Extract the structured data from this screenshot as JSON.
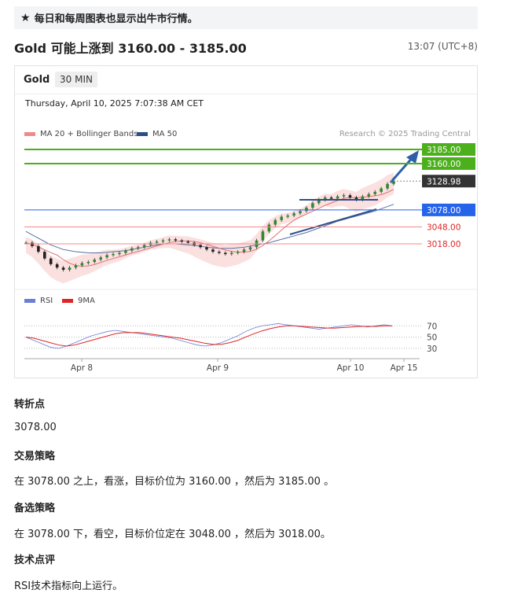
{
  "notice": {
    "icon": "star-icon",
    "text": "每日和每周图表也显示出牛市行情。"
  },
  "article": {
    "title": "Gold 可能上涨到 3160.00 - 3185.00",
    "time": "13:07 (UTC+8)"
  },
  "chart_card": {
    "asset": "Gold",
    "timeframe": "30 MIN",
    "datetime": "Thursday, April 10, 2025 7:07:38 AM CET"
  },
  "chart_data": {
    "type": "line",
    "legend": [
      {
        "name": "MA 20 + Bollinger Bands",
        "color": "#f08a8a"
      },
      {
        "name": "MA 50",
        "color": "#2d4f86"
      }
    ],
    "credit": "Research © 2025 Trading Central",
    "ylim": [
      3000,
      3200
    ],
    "levels": [
      {
        "value": "3185.00",
        "y": 3185,
        "style": "green"
      },
      {
        "value": "3160.00",
        "y": 3160,
        "style": "green"
      },
      {
        "value": "3128.98",
        "y": 3128.98,
        "style": "current"
      },
      {
        "value": "3078.00",
        "y": 3078,
        "style": "pivot"
      },
      {
        "value": "3048.00",
        "y": 3048,
        "style": "support"
      },
      {
        "value": "3018.00",
        "y": 3018,
        "style": "support"
      }
    ],
    "colors": {
      "green": "#4caf1c",
      "pivot": "#2563eb",
      "current": "#333333",
      "support": "#e02424",
      "ma50": "#5a6fa8",
      "bb": "#f7c6c6"
    },
    "price_close": [
      3020,
      3014,
      3004,
      2992,
      2982,
      2976,
      2972,
      2976,
      2980,
      2984,
      2986,
      2990,
      2994,
      2998,
      3000,
      3002,
      3006,
      3010,
      3012,
      3016,
      3020,
      3022,
      3024,
      3026,
      3024,
      3022,
      3020,
      3016,
      3012,
      3008,
      3004,
      3002,
      3000,
      3002,
      3004,
      3008,
      3012,
      3024,
      3040,
      3052,
      3060,
      3066,
      3068,
      3072,
      3076,
      3082,
      3090,
      3096,
      3100,
      3098,
      3102,
      3104,
      3100,
      3096,
      3102,
      3106,
      3110,
      3116,
      3124,
      3129
    ],
    "ma50": [
      3040,
      3034,
      3028,
      3022,
      3016,
      3012,
      3008,
      3006,
      3004,
      3003,
      3002,
      3002,
      3002,
      3003,
      3004,
      3005,
      3006,
      3008,
      3010,
      3012,
      3014,
      3016,
      3018,
      3018,
      3018,
      3017,
      3016,
      3015,
      3014,
      3012,
      3011,
      3010,
      3010,
      3010,
      3011,
      3012,
      3014,
      3016,
      3018,
      3020,
      3023,
      3026,
      3029,
      3032,
      3035,
      3038,
      3042,
      3046,
      3050,
      3054,
      3058,
      3061,
      3064,
      3067,
      3070,
      3073,
      3076,
      3080,
      3084,
      3088
    ],
    "rsi_legend": [
      {
        "name": "RSI",
        "color": "#6b7fd7"
      },
      {
        "name": "9MA",
        "color": "#e02424"
      }
    ],
    "rsi_ticks": [
      "70",
      "50",
      "30"
    ],
    "rsi": [
      50,
      44,
      38,
      32,
      30,
      34,
      40,
      46,
      52,
      56,
      60,
      62,
      60,
      58,
      56,
      54,
      52,
      50,
      48,
      44,
      40,
      36,
      34,
      36,
      40,
      46,
      52,
      60,
      66,
      70,
      72,
      74,
      72,
      70,
      68,
      66,
      64,
      66,
      68,
      70,
      72,
      70,
      68,
      70,
      72,
      70
    ],
    "rsi_ma": [
      50,
      48,
      44,
      40,
      36,
      34,
      36,
      40,
      44,
      48,
      52,
      56,
      58,
      58,
      58,
      56,
      54,
      52,
      50,
      48,
      45,
      42,
      39,
      37,
      37,
      40,
      44,
      50,
      56,
      61,
      65,
      68,
      70,
      70,
      69,
      68,
      67,
      66,
      66,
      67,
      68,
      69,
      69,
      69,
      70,
      70
    ],
    "x_ticks": [
      "Apr 8",
      "Apr 9",
      "Apr 10",
      "Apr 15"
    ]
  },
  "sections": [
    {
      "label": "转折点",
      "text": "3078.00"
    },
    {
      "label": "交易策略",
      "text": "在 3078.00 之上，看涨，目标价位为 3160.00 ，然后为 3185.00 。"
    },
    {
      "label": "备选策略",
      "text": "在 3078.00 下，看空，目标价位定在 3048.00 ，然后为 3018.00。"
    },
    {
      "label": "技术点评",
      "text": "RSI技术指标向上运行。"
    }
  ]
}
